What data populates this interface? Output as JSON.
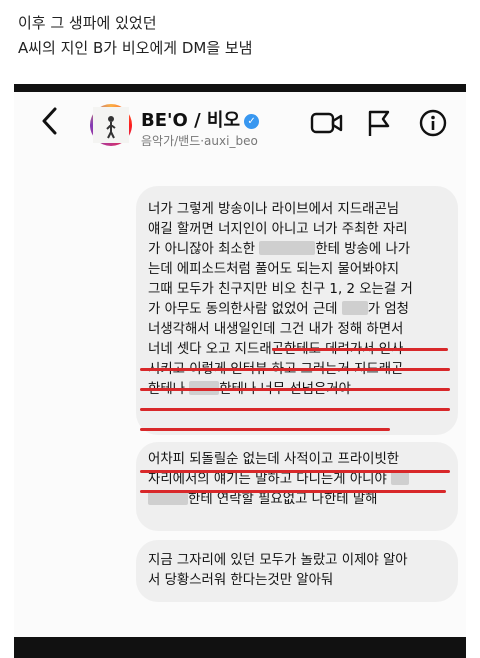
{
  "caption": {
    "line1": "이후 그 생파에 있었던",
    "line2": "A씨의 지인 B가 비오에게 DM을 보냄"
  },
  "header": {
    "name": "BE'O / 비오",
    "subtitle": "음악가/밴드·auxi_beo",
    "back_icon": "chevron-left-icon",
    "icons": [
      "video-call-icon",
      "flag-icon",
      "info-icon"
    ]
  },
  "messages": [
    {
      "lines": [
        "너가 그렇게 방송이나 라이브에서 지드래곤님",
        "얘길 할꺼면 너지인이 아니고 너가 주최한 자리",
        [
          "가 아니잖아 최소한 ",
          "[blur]",
          "한테 방송에 나가"
        ],
        "는데 에피소드처럼 풀어도 되는지 물어봐야지",
        "그때 모두가 친구지만 비오 친구 1, 2 오는걸 거",
        [
          "가 아무도 동의한사람 없었어 근데 ",
          "[blur]",
          "가 엄청"
        ],
        "너생각해서 내생일인데 그건 내가 정해 하면서",
        "너네 셋다 오고 지드래곤한테도 데려가서 인사",
        "시키고 이렇게 인터뷰 하고 그러는거 지드래곤",
        [
          "한테나 ",
          "[blur]",
          "한테나 너무 선넘은거야"
        ]
      ]
    },
    {
      "lines": [
        "어차피 되돌릴순 없는데 사적이고 프라이빗한",
        [
          "자리에서의 얘기는 말하고 다니는게 아니야",
          "[blur]"
        ],
        [
          "[blur]",
          "한테 연락할 필요없고 나한테 말해"
        ]
      ]
    },
    {
      "lines": [
        "지금 그자리에 있던 모두가 놀랐고 이제야 알아",
        "서 당황스러워 한다는것만 알아둬"
      ]
    }
  ],
  "colors": {
    "underline": "#d8282a",
    "bubble": "#efefef",
    "verified": "#3897f0"
  }
}
